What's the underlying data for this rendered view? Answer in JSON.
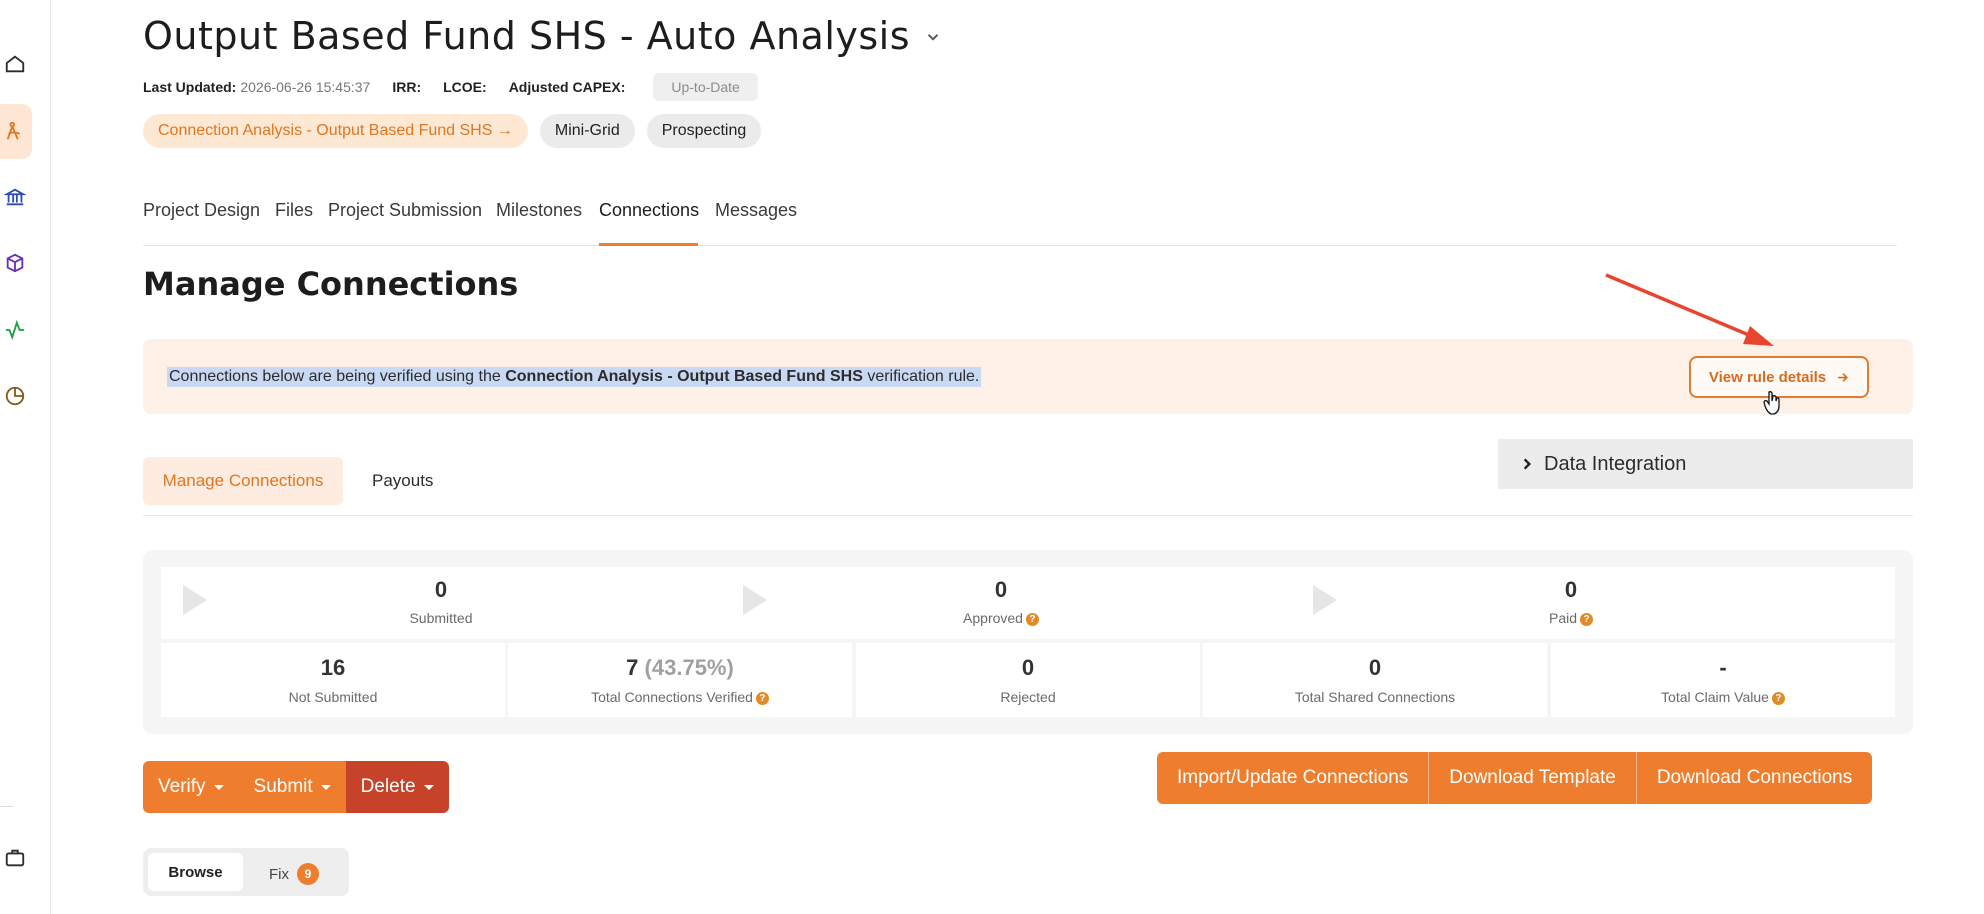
{
  "header": {
    "title": "Output Based Fund SHS - Auto Analysis",
    "meta": {
      "last_updated_label": "Last Updated:",
      "last_updated_value": "2026-06-26 15:45:37",
      "irr_label": "IRR:",
      "lcoe_label": "LCOE:",
      "capex_label": "Adjusted CAPEX:",
      "status": "Up-to-Date"
    },
    "tags": {
      "connection_analysis": "Connection Analysis - Output Based Fund SHS →",
      "mini_grid": "Mini-Grid",
      "prospecting": "Prospecting"
    }
  },
  "tabs": [
    "Project Design",
    "Files",
    "Project Submission",
    "Milestones",
    "Connections",
    "Messages"
  ],
  "active_tab": "Connections",
  "section_title": "Manage Connections",
  "banner": {
    "text_before": "Connections below are being verified using the ",
    "rule_name": "Connection Analysis - Output Based Fund SHS",
    "text_after": " verification rule.",
    "button_label": "View rule details"
  },
  "subtabs": {
    "manage": "Manage Connections",
    "payouts": "Payouts",
    "data_integration": "Data Integration"
  },
  "stages": [
    {
      "value": "0",
      "label": "Submitted",
      "help": false
    },
    {
      "value": "0",
      "label": "Approved",
      "help": true
    },
    {
      "value": "0",
      "label": "Paid",
      "help": true
    }
  ],
  "cells": [
    {
      "value": "16",
      "pct": "",
      "label": "Not Submitted",
      "help": false
    },
    {
      "value": "7",
      "pct": "(43.75%)",
      "label": "Total Connections Verified",
      "help": true
    },
    {
      "value": "0",
      "pct": "",
      "label": "Rejected",
      "help": false
    },
    {
      "value": "0",
      "pct": "",
      "label": "Total Shared Connections",
      "help": false
    },
    {
      "value": "-",
      "pct": "",
      "label": "Total Claim Value",
      "help": true
    }
  ],
  "actions": {
    "verify": "Verify",
    "submit": "Submit",
    "delete": "Delete",
    "import": "Import/Update Connections",
    "download_template": "Download Template",
    "download_connections": "Download Connections"
  },
  "mode": {
    "browse": "Browse",
    "fix": "Fix",
    "fix_count": "9"
  },
  "colors": {
    "accent": "#ef7d2e",
    "danger": "#c6432a",
    "banner_bg": "#fdf0e6"
  }
}
